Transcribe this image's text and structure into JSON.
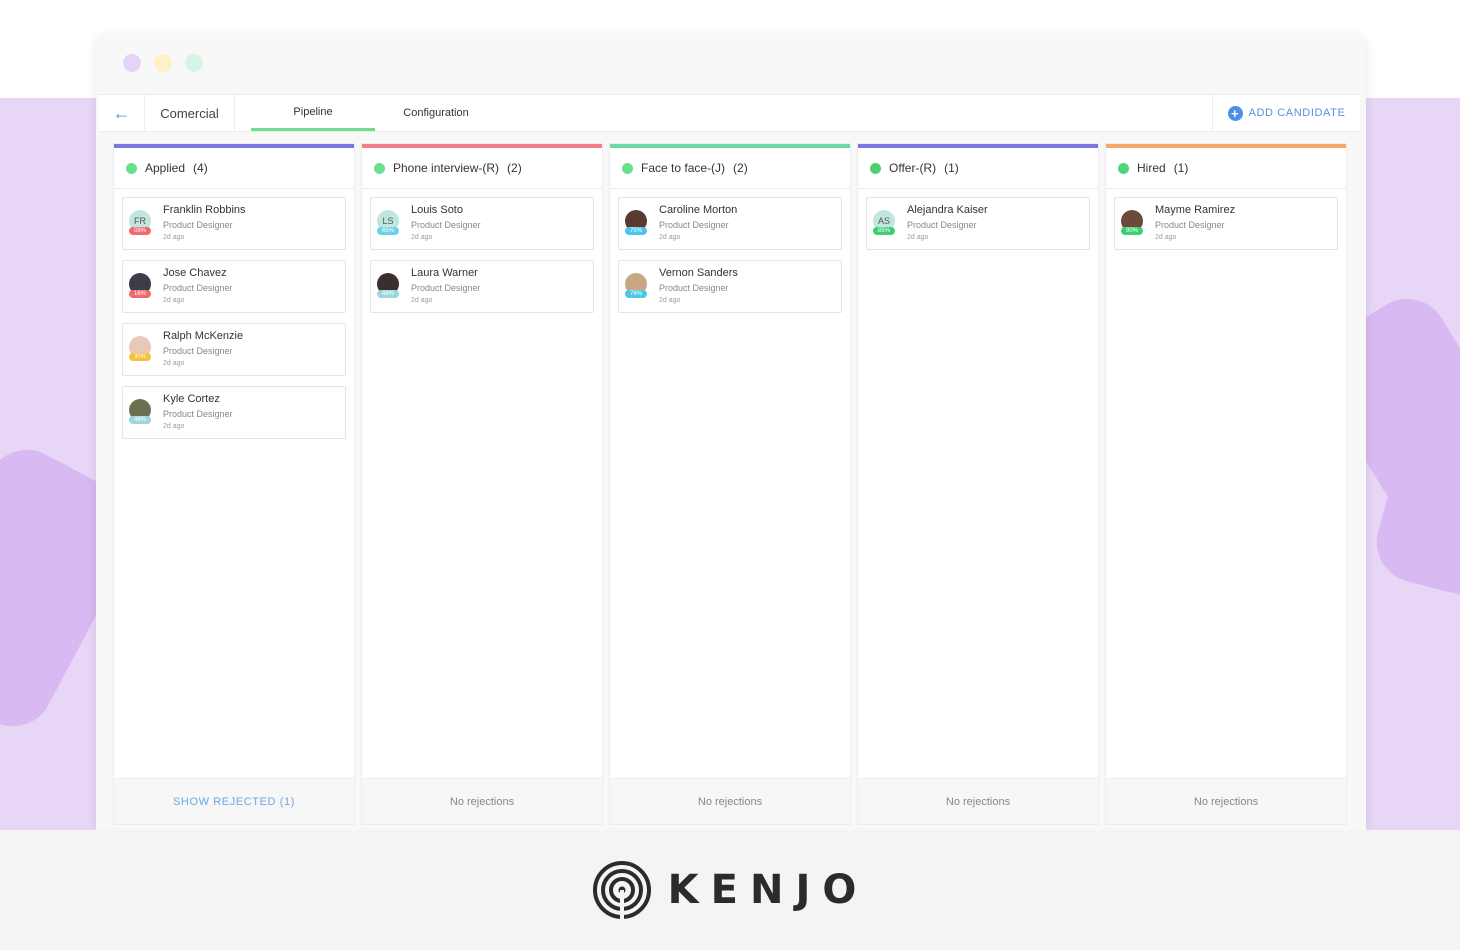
{
  "colors": {
    "accent": "#5a8fdc",
    "background_band": "#e8d6f7",
    "pipeline_tab": "#6adf8c"
  },
  "window": {
    "traffic_lights": [
      "#e6d4f8",
      "#fdf2c6",
      "#d6f6e4"
    ],
    "back_icon": "arrow-left-icon",
    "company": "Comercial",
    "tabs": [
      {
        "label": "Pipeline",
        "active": true
      },
      {
        "label": "Configuration",
        "active": false
      }
    ],
    "add_candidate": "ADD CANDIDATE",
    "add_icon": "plus-circle-icon"
  },
  "columns": [
    {
      "title": "Applied",
      "count": "(4)",
      "color": "#7b76e2",
      "pie_color": "#6adf8c",
      "footer": "SHOW REJECTED (1)",
      "footer_link": true,
      "cards": [
        {
          "name": "Franklin Robbins",
          "role": "Product Designer",
          "time": "2d ago",
          "initials": "FR",
          "avatar_color": "#bfe6e0",
          "pct": "08%",
          "pct_color": "#ef6b6b"
        },
        {
          "name": "Jose Chavez",
          "role": "Product Designer",
          "time": "2d ago",
          "initials": "",
          "avatar_color": "#3d3d4a",
          "pct": "16%",
          "pct_color": "#ef6b6b"
        },
        {
          "name": "Ralph McKenzie",
          "role": "Product Designer",
          "time": "2d ago",
          "initials": "",
          "avatar_color": "#e8c9b6",
          "pct": "30%",
          "pct_color": "#f4c13a"
        },
        {
          "name": "Kyle Cortez",
          "role": "Product Designer",
          "time": "2d ago",
          "initials": "",
          "avatar_color": "#6b7050",
          "pct": "46%",
          "pct_color": "#9ad7df"
        }
      ]
    },
    {
      "title": "Phone interview-(R)",
      "count": "(2)",
      "color": "#ef7d8b",
      "pie_color": "#6adf8c",
      "footer": "No rejections",
      "footer_link": false,
      "cards": [
        {
          "name": "Louis Soto",
          "role": "Product Designer",
          "time": "2d ago",
          "initials": "LS",
          "avatar_color": "#bfe6e0",
          "pct": "65%",
          "pct_color": "#6fd1e8"
        },
        {
          "name": "Laura Warner",
          "role": "Product Designer",
          "time": "2d ago",
          "initials": "",
          "avatar_color": "#3a2f2f",
          "pct": "48%",
          "pct_color": "#9ad7df"
        }
      ]
    },
    {
      "title": "Face to face-(J)",
      "count": "(2)",
      "color": "#6ed7a8",
      "pie_color": "#6adf8c",
      "footer": "No rejections",
      "footer_link": false,
      "cards": [
        {
          "name": "Caroline Morton",
          "role": "Product Designer",
          "time": "2d ago",
          "initials": "",
          "avatar_color": "#5a3a2f",
          "pct": "75%",
          "pct_color": "#4ec6e8"
        },
        {
          "name": "Vernon Sanders",
          "role": "Product Designer",
          "time": "2d ago",
          "initials": "",
          "avatar_color": "#c7a882",
          "pct": "76%",
          "pct_color": "#4ec6e8"
        }
      ]
    },
    {
      "title": "Offer-(R)",
      "count": "(1)",
      "color": "#7b76e2",
      "pie_color": "#4fcf72",
      "footer": "No rejections",
      "footer_link": false,
      "cards": [
        {
          "name": "Alejandra Kaiser",
          "role": "Product Designer",
          "time": "2d ago",
          "initials": "AS",
          "avatar_color": "#bfe6e0",
          "pct": "85%",
          "pct_color": "#3ecf72"
        }
      ]
    },
    {
      "title": "Hired",
      "count": "(1)",
      "color": "#f6a96c",
      "pie_color": "#4fd67a",
      "footer": "No rejections",
      "footer_link": false,
      "cards": [
        {
          "name": "Mayme Ramirez",
          "role": "Product Designer",
          "time": "2d ago",
          "initials": "",
          "avatar_color": "#6b4a3a",
          "pct": "90%",
          "pct_color": "#3ecf72"
        }
      ]
    }
  ],
  "brand": {
    "name": "KENJO",
    "icon": "kenjo-logo-icon"
  }
}
